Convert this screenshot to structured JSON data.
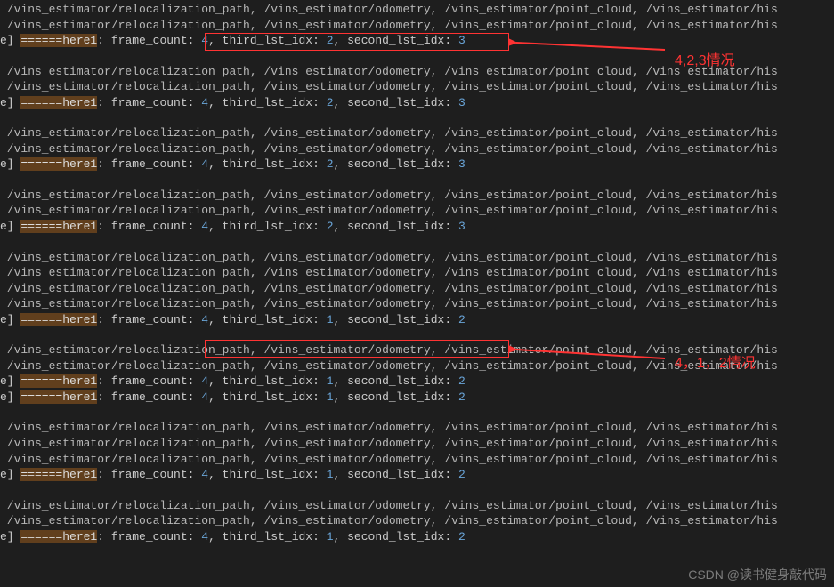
{
  "topics_line": " /vins_estimator/relocalization_path, /vins_estimator/odometry, /vins_estimator/point_cloud, /vins_estimator/his",
  "prefix_e": "e] ",
  "here_marker": "======here1",
  "labels": {
    "frame_count": ": frame_count: ",
    "third": ", third_lst_idx: ",
    "second": ", second_lst_idx: "
  },
  "val_423": {
    "fc": "4",
    "t": "2",
    "s": "3"
  },
  "val_412": {
    "fc": "4",
    "t": "1",
    "s": "2"
  },
  "annotation1": "4,2,3情况",
  "annotation2": "4，1，2情况",
  "watermark": "CSDN @读书健身敲代码"
}
